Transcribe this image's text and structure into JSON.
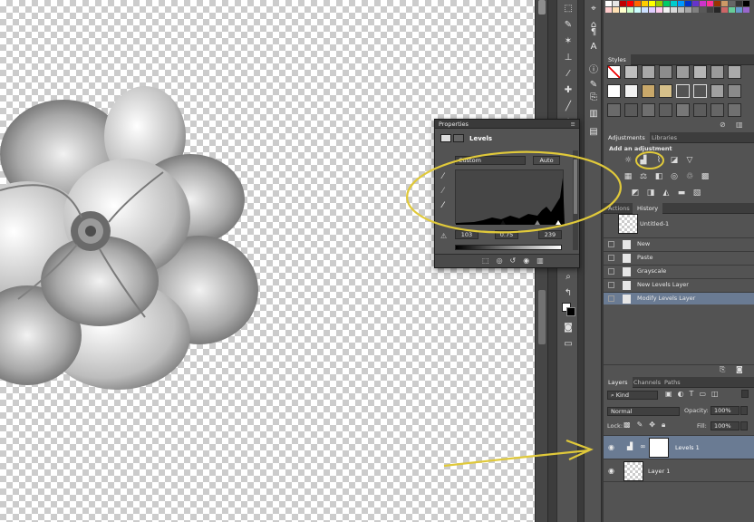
{
  "properties_panel": {
    "tab": "Properties",
    "kind": "Levels",
    "preset": "Custom",
    "auto_label": "Auto",
    "input_values": [
      "103",
      "0.75",
      "239"
    ]
  },
  "styles_panel": {
    "tab": "Styles"
  },
  "adjustments_panel": {
    "tabs": [
      "Adjustments",
      "Libraries"
    ],
    "title": "Add an adjustment"
  },
  "history_panel": {
    "tabs": [
      "Actions",
      "History"
    ],
    "snapshot": "Untitled-1",
    "items": [
      "New",
      "Paste",
      "Grayscale",
      "New Levels Layer",
      "Modify Levels Layer"
    ],
    "selected_index": 4
  },
  "layers_panel": {
    "tabs": [
      "Layers",
      "Channels",
      "Paths"
    ],
    "filter": "Kind",
    "blend_mode": "Normal",
    "opacity_label": "Opacity:",
    "opacity": "100%",
    "lock_label": "Lock:",
    "fill_label": "Fill:",
    "fill": "100%",
    "layers": [
      {
        "name": "Levels 1",
        "selected": true
      },
      {
        "name": "Layer 1",
        "selected": false
      }
    ]
  },
  "colors": {
    "panel_bg": "#535353",
    "selected_row": "#6a7b93",
    "annotation_yellow": "#e0c93a"
  },
  "swatch_colors": [
    "#ffffff",
    "#e6e6e6",
    "#c00000",
    "#ff0000",
    "#ff6600",
    "#ffcc00",
    "#ffff00",
    "#99cc00",
    "#00cc66",
    "#00cccc",
    "#0099ff",
    "#0033cc",
    "#6633cc",
    "#cc33cc",
    "#ff3399",
    "#993300",
    "#cc9966",
    "#666666",
    "#333333",
    "#000000",
    "#ffcccc",
    "#ffe0b3",
    "#ffffcc",
    "#ccffcc",
    "#ccffff",
    "#cce0ff",
    "#e0ccff",
    "#ffccee",
    "#f2f2f2",
    "#d9d9d9",
    "#bfbfbf",
    "#a6a6a6",
    "#808080",
    "#595959",
    "#3f3f3f",
    "#262626",
    "#cc6666",
    "#66cc99",
    "#6699cc",
    "#9966cc"
  ]
}
